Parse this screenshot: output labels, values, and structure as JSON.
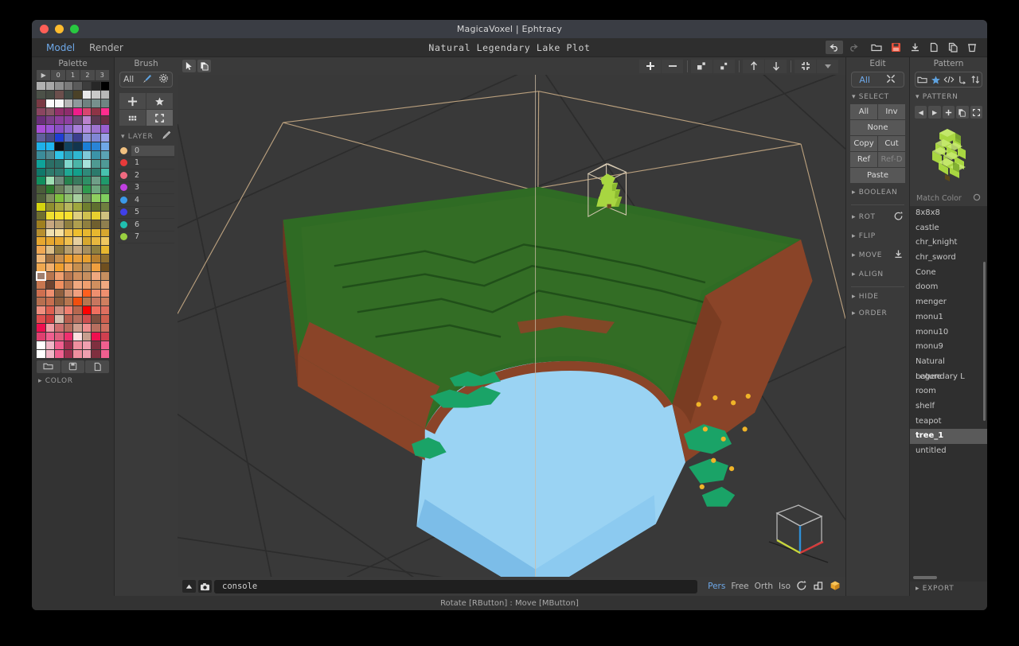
{
  "window": {
    "app_title": "MagicaVoxel | Ephtracy",
    "document_title": "Natural Legendary Lake Plot",
    "traffic_lights": [
      "close",
      "minimize",
      "maximize"
    ]
  },
  "menubar": {
    "items": [
      {
        "label": "Model",
        "active": true
      },
      {
        "label": "Render",
        "active": false
      }
    ],
    "tools": [
      {
        "name": "undo-button",
        "glyph": "↶",
        "enabled": true
      },
      {
        "name": "redo-button",
        "glyph": "↷",
        "enabled": false
      },
      {
        "name": "open-file-button",
        "glyph": "folder",
        "enabled": true
      },
      {
        "name": "save-file-button",
        "glyph": "save",
        "enabled": true,
        "color": "#e8503a"
      },
      {
        "name": "download-button",
        "glyph": "download",
        "enabled": true
      },
      {
        "name": "new-file-button",
        "glyph": "page",
        "enabled": true
      },
      {
        "name": "copy-file-button",
        "glyph": "pages",
        "enabled": true
      },
      {
        "name": "delete-file-button",
        "glyph": "trash",
        "enabled": true
      }
    ]
  },
  "palette": {
    "title": "Palette",
    "index_labels": [
      "▶",
      "0",
      "1",
      "2",
      "3"
    ],
    "selected_index": 176,
    "footer_buttons": [
      "open-palette",
      "save-palette",
      "new-palette"
    ],
    "color_section_label": "COLOR",
    "colors": [
      "#b0b0b0",
      "#a7a7a7",
      "#8f8f8f",
      "#7a7a7a",
      "#5a5a5a",
      "#3d3d3d",
      "#272727",
      "#000000",
      "#4c5148",
      "#454a42",
      "#6b4f4c",
      "#3f4a44",
      "#4a4127",
      "#e8e8e8",
      "#c9c9c9",
      "#b8b8b8",
      "#7a3a44",
      "#fbfbfb",
      "#f7f7f7",
      "#b6b6b6",
      "#8f9a9c",
      "#6f8280",
      "#77908d",
      "#6e8582",
      "#8a4560",
      "#8a5566",
      "#92306b",
      "#8e2c6c",
      "#ef1d8a",
      "#d9456f",
      "#8e3446",
      "#ff2d8e",
      "#6a2f7a",
      "#7c3f8a",
      "#8c3f9c",
      "#8e3fa0",
      "#6d4f78",
      "#bb82cc",
      "#5c3a52",
      "#6a2f44",
      "#a94fd6",
      "#9b55d6",
      "#8a4fc4",
      "#8f66cc",
      "#a97fd9",
      "#b48ce0",
      "#9f74cf",
      "#9a5fd0",
      "#5f5f9a",
      "#4a4a86",
      "#1f3fd4",
      "#5a6fc0",
      "#3b3f8e",
      "#8f93d9",
      "#8087d4",
      "#9aa0e6",
      "#1fb0e8",
      "#1fb5ef",
      "#0a0f14",
      "#11425e",
      "#12354e",
      "#1b7fd6",
      "#2a84d6",
      "#6fa8e8",
      "#3b8c9a",
      "#4f8a92",
      "#2fc2e6",
      "#2a9fb8",
      "#2fb6d1",
      "#7fc9d9",
      "#3b93a8",
      "#5aa2b4",
      "#0fa39a",
      "#2b6f66",
      "#2b6f68",
      "#7fd6cc",
      "#4bb5a8",
      "#a7e3db",
      "#4f9a92",
      "#4f9a96",
      "#10786a",
      "#2e7a6c",
      "#2f7a6f",
      "#1fa894",
      "#13a08b",
      "#2f8a7a",
      "#2b7a6c",
      "#47c2ae",
      "#128f5e",
      "#9fe0b4",
      "#6f8c7c",
      "#27824f",
      "#3a7a5e",
      "#2f8f66",
      "#6f9f88",
      "#1f9a6b",
      "#4b5c3a",
      "#2e7a2e",
      "#6a7f5a",
      "#7fa07f",
      "#7f9a7f",
      "#2f9a4f",
      "#6fa87f",
      "#3f7f4f",
      "#4f5f3a",
      "#7f8f5f",
      "#7fbf3f",
      "#8fbf6f",
      "#a7cf9f",
      "#6f8f5f",
      "#8fcf5f",
      "#7fcf5f",
      "#d4d40f",
      "#8f8f2f",
      "#a7a73f",
      "#b7b75f",
      "#9fa73f",
      "#6f7f2f",
      "#5f6f2f",
      "#6f7f3f",
      "#6f6f2f",
      "#efdf2f",
      "#f7e02f",
      "#f7e02f",
      "#dfcf7f",
      "#cfc04f",
      "#e7cf2f",
      "#cfc07f",
      "#9f7f1f",
      "#c7a77f",
      "#b79f6f",
      "#8f7f3f",
      "#af9f4f",
      "#8f7f3f",
      "#6f5f2f",
      "#8f7f4f",
      "#b78f2f",
      "#efdfaf",
      "#f7df9f",
      "#efbf4f",
      "#efbf2f",
      "#e7b72f",
      "#e7b72f",
      "#d7a72f",
      "#e7a72f",
      "#e7a72f",
      "#e7a72f",
      "#efbf4f",
      "#e7cf9f",
      "#d7a72f",
      "#e7b73f",
      "#efc75f",
      "#f0a854",
      "#ddc08a",
      "#8f7a3f",
      "#b79f6f",
      "#c7a77f",
      "#a78f5f",
      "#8f7f3f",
      "#e7b72f",
      "#f0b878",
      "#9f6f3f",
      "#c78f4f",
      "#ef9f2f",
      "#e79f3f",
      "#e79f2f",
      "#b77f2f",
      "#8f6f2f",
      "#efa84f",
      "#f0b06f",
      "#ef9f2f",
      "#f0a85f",
      "#c78f4f",
      "#b78f5f",
      "#ef9f3f",
      "#6f4f1f",
      "#9f7f6f",
      "#b7764f",
      "#ef9f6f",
      "#b7764f",
      "#cf8f5f",
      "#c78f5f",
      "#f0a87f",
      "#c78f5f",
      "#c7764f",
      "#6f4430",
      "#ef8f5f",
      "#b7764f",
      "#f0a87f",
      "#ef9f6f",
      "#cf8f5f",
      "#f0a87f",
      "#cf6f4f",
      "#ef8f6f",
      "#8f5f3f",
      "#cf8f6f",
      "#ef9f7f",
      "#ff5f1f",
      "#ef8f6f",
      "#ef8f6f",
      "#b76f4f",
      "#c76f4f",
      "#8f5f3f",
      "#b7764f",
      "#f04f0f",
      "#b7764f",
      "#c7765f",
      "#cf7f5f",
      "#f08f7f",
      "#df5f4f",
      "#cf8f7f",
      "#ef7f6f",
      "#b7674f",
      "#ff0000",
      "#ef6f5f",
      "#df6f5f",
      "#df4f4f",
      "#cf3f3f",
      "#d7bfaf",
      "#b75f4f",
      "#b76f5f",
      "#cf4f4f",
      "#7f4f3f",
      "#cf5f4f",
      "#ef0f4f",
      "#f0a0a7",
      "#cf6f6f",
      "#b76f5f",
      "#cf9f8f",
      "#ef8f8f",
      "#b76f5f",
      "#cf6f5f",
      "#df3f6f",
      "#ef5f8f",
      "#df5f7f",
      "#ef2f6f",
      "#fddfe0",
      "#c79f8f",
      "#ef0f4f",
      "#cf3f4f",
      "#ffffff",
      "#f0b7c7",
      "#ef5f8f",
      "#9f2f4f",
      "#ef8f9f",
      "#ef9faf",
      "#7f2f3f",
      "#ef5f8f",
      "#ffffff",
      "#f0b7c7",
      "#ef5f8f",
      "#9f2f4f",
      "#ef8f9f",
      "#ef9faf",
      "#7f2f3f",
      "#ef5f8f"
    ]
  },
  "brush": {
    "title": "Brush",
    "mode_label": "All",
    "mode_icons": [
      "brush-icon",
      "gear-icon"
    ],
    "tool_cells": [
      {
        "name": "move-tool",
        "glyph": "✥",
        "active": false
      },
      {
        "name": "star-tool",
        "glyph": "★",
        "active": false
      },
      {
        "name": "grid-tool",
        "glyph": "grid",
        "active": false
      },
      {
        "name": "frame-tool",
        "glyph": "frame",
        "active": true
      }
    ],
    "layer_section": {
      "label": "LAYER",
      "edit_icon": "pencil-icon",
      "selected": "0",
      "items": [
        {
          "name": "0",
          "color": "#f0c080"
        },
        {
          "name": "1",
          "color": "#e83a3a"
        },
        {
          "name": "2",
          "color": "#f06a80"
        },
        {
          "name": "3",
          "color": "#c040e0"
        },
        {
          "name": "4",
          "color": "#3b9ae8"
        },
        {
          "name": "5",
          "color": "#4040e8"
        },
        {
          "name": "6",
          "color": "#20c0b0"
        },
        {
          "name": "7",
          "color": "#9ad040"
        }
      ]
    }
  },
  "viewport": {
    "left_tools": [
      {
        "name": "select-pointer-tool",
        "glyph": "▶"
      },
      {
        "name": "duplicate-tool",
        "glyph": "pages"
      }
    ],
    "right_tools": [
      {
        "name": "add-voxel-button",
        "glyph": "+"
      },
      {
        "name": "remove-voxel-button",
        "glyph": "−"
      },
      {
        "name": "scale-up-button",
        "glyph": "expand"
      },
      {
        "name": "scale-down-button",
        "glyph": "contract"
      },
      {
        "name": "move-up-button",
        "glyph": "↑"
      },
      {
        "name": "move-down-button",
        "glyph": "↓"
      },
      {
        "name": "fit-view-button",
        "glyph": "fit"
      },
      {
        "name": "more-options-button",
        "glyph": "▼"
      }
    ],
    "console": {
      "value": "console",
      "placeholder": "console",
      "toggle_icon": "triangle-up-icon",
      "screenshot_icon": "camera-icon"
    },
    "projection": {
      "modes": [
        "Pers",
        "Free",
        "Orth",
        "Iso"
      ],
      "active": "Pers",
      "extra_icons": [
        "reset-view-icon",
        "grid-floor-icon",
        "shade-cube-icon"
      ]
    },
    "status_hint": "Rotate [RButton] : Move [MButton]",
    "gizmo": {
      "name": "axis-cube-gizmo",
      "axes": [
        {
          "axis": "z",
          "color": "#2f8fd6"
        },
        {
          "axis": "x",
          "color": "#d63a3a"
        },
        {
          "axis": "y",
          "color": "#c8d63a"
        }
      ]
    },
    "scene": {
      "grass_color": "#2f6b24",
      "grass_top_color": "#347a28",
      "dirt_color": "#8a4428",
      "water_color": "#8fcdf0",
      "water_side_color": "#79b9e3",
      "bush_color": "#1aa367",
      "flower_color": "#f0b428",
      "tree_color": "#a8d641",
      "bbox_color": "#c9a77f"
    }
  },
  "edit": {
    "title": "Edit",
    "mode_label": "All",
    "mode_icon": "scatter-icon",
    "sections": [
      {
        "label": "SELECT",
        "open": true,
        "icon": null
      },
      {
        "label": "BOOLEAN",
        "open": false,
        "icon": null
      },
      {
        "label": "ROT",
        "open": false,
        "icon": "rotate-icon"
      },
      {
        "label": "FLIP",
        "open": false,
        "icon": null
      },
      {
        "label": "MOVE",
        "open": false,
        "icon": "move-down-icon"
      },
      {
        "label": "ALIGN",
        "open": false,
        "icon": null
      },
      {
        "label": "HIDE",
        "open": false,
        "icon": null
      },
      {
        "label": "ORDER",
        "open": false,
        "icon": null
      }
    ],
    "select_buttons": [
      {
        "label": "All",
        "width": "half",
        "enabled": true
      },
      {
        "label": "Inv",
        "width": "half",
        "enabled": true
      },
      {
        "label": "None",
        "width": "full",
        "enabled": true
      },
      {
        "label": "Copy",
        "width": "half",
        "enabled": true
      },
      {
        "label": "Cut",
        "width": "half",
        "enabled": true
      },
      {
        "label": "Ref",
        "width": "half",
        "enabled": true
      },
      {
        "label": "Ref-D",
        "width": "half",
        "enabled": false
      },
      {
        "label": "Paste",
        "width": "full",
        "enabled": true
      }
    ]
  },
  "pattern": {
    "title": "Pattern",
    "tool_icons": [
      "folder-icon",
      "star-icon",
      "code-icon",
      "branch-icon",
      "sort-icon"
    ],
    "section_label": "PATTERN",
    "nav_buttons": [
      {
        "name": "prev-pattern-button",
        "glyph": "◀"
      },
      {
        "name": "next-pattern-button",
        "glyph": "▶"
      },
      {
        "name": "add-pattern-button",
        "glyph": "+"
      },
      {
        "name": "copy-pattern-button",
        "glyph": "pages"
      },
      {
        "name": "expand-pattern-button",
        "glyph": "frame"
      }
    ],
    "preview_name": "tree-preview",
    "match_color_label": "Match Color",
    "match_color_toggle": "circle-icon",
    "selected_item": "tree_1",
    "items": [
      "8x8x8",
      "castle",
      "chr_knight",
      "chr_sword",
      "Cone",
      "doom",
      "menger",
      "monu1",
      "monu10",
      "monu9",
      "Natural Legendary L",
      "nature",
      "room",
      "shelf",
      "teapot",
      "tree_1",
      "untitled"
    ],
    "export_label": "EXPORT"
  }
}
